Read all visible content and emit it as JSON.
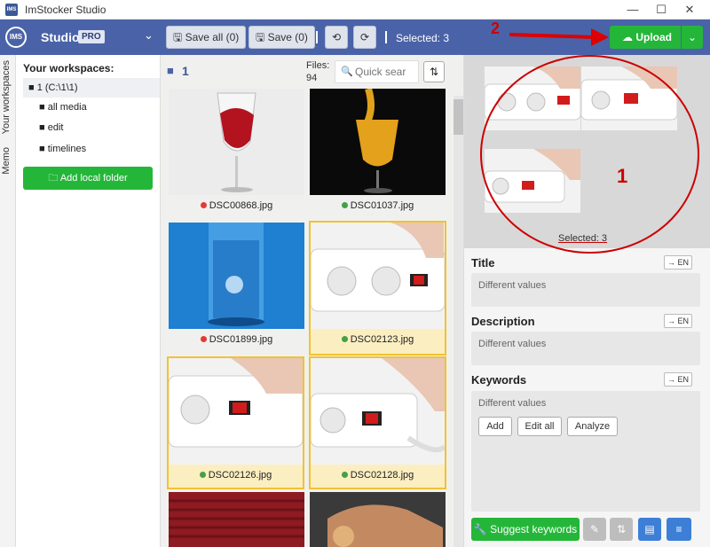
{
  "window": {
    "title": "ImStocker Studio",
    "icon_text": "IMS",
    "minimize": "—",
    "maximize": "☐",
    "close": "✕"
  },
  "header": {
    "logo": "IMS",
    "studio": "Studio",
    "pro": "PRO",
    "chevron": "⌄",
    "save_all": "Save all (0)",
    "save": "Save (0)",
    "undo": "⟲",
    "redo": "⟳",
    "selected": "Selected: 3",
    "upload": "Upload",
    "upload_dropdown": "⌄"
  },
  "annotations": {
    "two": "2",
    "one": "1"
  },
  "tabs": {
    "workspaces": "Your workspaces",
    "memo": "Memo"
  },
  "workspaces": {
    "title": "Your workspaces:",
    "root": "1 (C:\\1\\1)",
    "items": [
      "all media",
      "edit",
      "timelines"
    ],
    "add_label": "Add local folder"
  },
  "files": {
    "folder_name": "1",
    "count_label": "Files:",
    "count": "94",
    "search_placeholder": "Quick sear",
    "thumbs": [
      {
        "name": "DSC00868.jpg",
        "status": "red"
      },
      {
        "name": "DSC01037.jpg",
        "status": "green"
      },
      {
        "name": "DSC01899.jpg",
        "status": "red"
      },
      {
        "name": "DSC02123.jpg",
        "status": "green"
      },
      {
        "name": "DSC02126.jpg",
        "status": "green"
      },
      {
        "name": "DSC02128.jpg",
        "status": "green"
      }
    ]
  },
  "preview": {
    "selected": "Selected: 3"
  },
  "meta": {
    "title_label": "Title",
    "title_value": "Different values",
    "desc_label": "Description",
    "desc_value": "Different values",
    "kw_label": "Keywords",
    "kw_value": "Different values",
    "lang": "→ EN",
    "add": "Add",
    "edit_all": "Edit all",
    "analyze": "Analyze",
    "suggest": "Suggest keywords",
    "pencil": "✎",
    "sort": "⇅",
    "doc": "▤",
    "menu": "≡"
  }
}
